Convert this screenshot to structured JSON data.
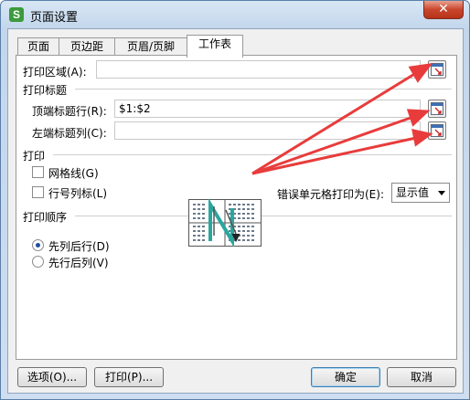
{
  "window": {
    "title": "页面设置",
    "app_icon_letter": "S",
    "close_glyph": "✕"
  },
  "tabs": [
    {
      "label": "页面",
      "active": false
    },
    {
      "label": "页边距",
      "active": false
    },
    {
      "label": "页眉/页脚",
      "active": false
    },
    {
      "label": "工作表",
      "active": true
    }
  ],
  "print_area": {
    "label": "打印区域(A):",
    "value": ""
  },
  "print_titles": {
    "section": "打印标题",
    "top_rows_label": "顶端标题行(R):",
    "top_rows_value": "$1:$2",
    "left_cols_label": "左端标题列(C):",
    "left_cols_value": ""
  },
  "print": {
    "section": "打印",
    "gridlines_label": "网格线(G)",
    "gridlines_checked": false,
    "row_col_headings_label": "行号列标(L)",
    "row_col_headings_checked": false,
    "cell_errors_label": "错误单元格打印为(E):",
    "cell_errors_value": "显示值"
  },
  "page_order": {
    "section": "打印顺序",
    "down_then_over_label": "先列后行(D)",
    "over_then_down_label": "先行后列(V)",
    "selected": "down_then_over"
  },
  "buttons": {
    "options": "选项(O)...",
    "print": "打印(P)...",
    "ok": "确定",
    "cancel": "取消"
  },
  "colors": {
    "annotation_arrow": "#e83c3c",
    "accent": "#1d4f9e"
  },
  "icons": {
    "range_picker": "range-picker-icon",
    "close": "close-icon"
  }
}
